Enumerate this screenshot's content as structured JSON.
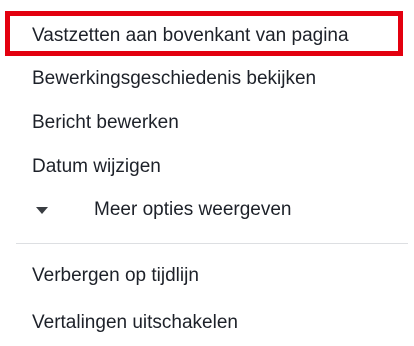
{
  "menu": {
    "items": [
      {
        "label": "Vastzetten aan bovenkant van pagina"
      },
      {
        "label": "Bewerkingsgeschiedenis bekijken"
      },
      {
        "label": "Bericht bewerken"
      },
      {
        "label": "Datum wijzigen"
      },
      {
        "label": "Meer opties weergeven",
        "icon": "triangle-down-icon"
      },
      {
        "label": "Verbergen op tijdlijn"
      },
      {
        "label": "Vertalingen uitschakelen"
      }
    ],
    "highlight_color": "#e3000f",
    "divider_color": "#dddfe2"
  }
}
